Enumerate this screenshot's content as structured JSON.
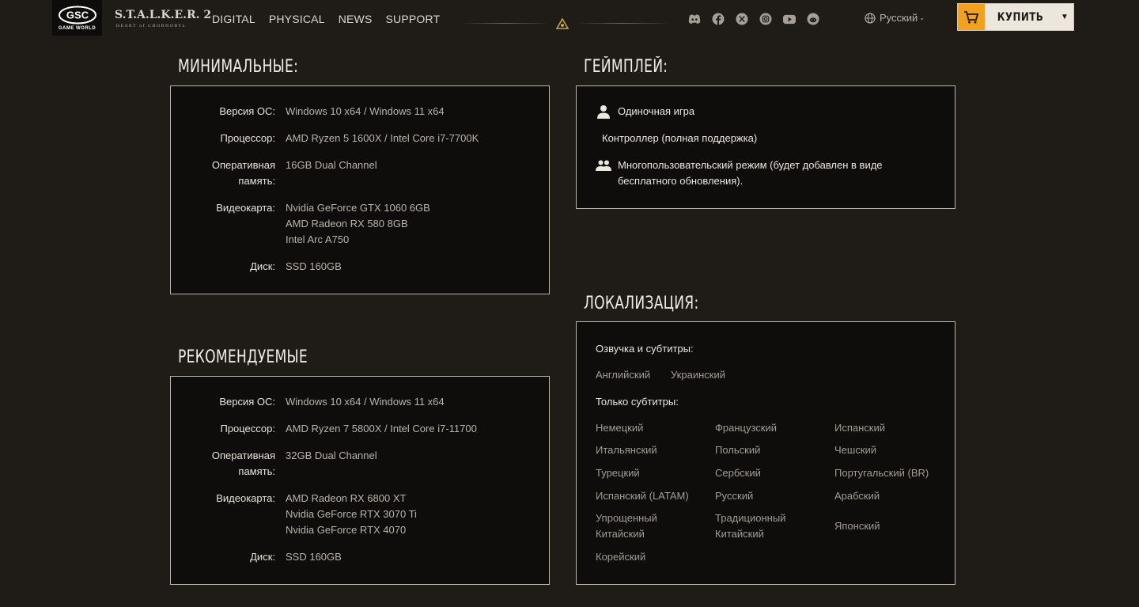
{
  "header": {
    "gsc_logo_text": "GAME WORLD",
    "stalker_title": "S.T.A.L.K.E.R. 2",
    "stalker_tagline": "HEART of CHORNOBYL",
    "nav": [
      "DIGITAL",
      "PHYSICAL",
      "NEWS",
      "SUPPORT"
    ],
    "socials": [
      "discord-icon",
      "facebook-icon",
      "x-icon",
      "instagram-icon",
      "youtube-icon",
      "reddit-icon"
    ],
    "language": "Русский",
    "buy_label": "КУПИТЬ",
    "accent_color": "#f2a01d"
  },
  "minimum": {
    "title": "МИНИМАЛЬНЫЕ:",
    "rows": [
      {
        "label": "Версия ОС:",
        "value": "Windows 10 x64 / Windows 11 x64"
      },
      {
        "label": "Процессор:",
        "value": "AMD Ryzen 5 1600X / Intel Core i7-7700K"
      },
      {
        "label": "Оперативная\nпамять:",
        "value": "16GB Dual Channel"
      },
      {
        "label": "Видеокарта:",
        "value": "Nvidia GeForce GTX 1060 6GB\nAMD Radeon RX 580 8GB\nIntel Arc A750"
      },
      {
        "label": "Диск:",
        "value": "SSD 160GB"
      }
    ]
  },
  "recommended": {
    "title": "РЕКОМЕНДУЕМЫЕ",
    "rows": [
      {
        "label": "Версия ОС:",
        "value": "Windows 10 x64 / Windows 11 x64"
      },
      {
        "label": "Процессор:",
        "value": "AMD Ryzen 7 5800X / Intel Core i7-11700"
      },
      {
        "label": "Оперативная\nпамять:",
        "value": "32GB Dual Channel"
      },
      {
        "label": "Видеокарта:",
        "value": "AMD Radeon RX 6800 XT\nNvidia GeForce RTX 3070 Ti\nNvidia GeForce RTX 4070"
      },
      {
        "label": "Диск:",
        "value": "SSD 160GB"
      }
    ]
  },
  "gameplay": {
    "title": "ГЕЙМПЛЕЙ:",
    "items": [
      {
        "icon": "single-player-icon",
        "text": "Одиночная игра"
      },
      {
        "icon": "",
        "text": "Контроллер (полная поддержка)"
      },
      {
        "icon": "multiplayer-icon",
        "text": "Многопользовательский режим (будет добавлен в виде\nбесплатного обновления)."
      }
    ]
  },
  "localization": {
    "title": "ЛОКАЛИЗАЦИЯ:",
    "voice_subs_label": "Озвучка и субтитры:",
    "voice_subs": [
      "Английский",
      "Украинский"
    ],
    "subs_only_label": "Только субтитры:",
    "subs_only": [
      "Немецкий",
      "Французский",
      "Испанский",
      "Итальянский",
      "Польский",
      "Чешский",
      "Турецкий",
      "Сербский",
      "Португальский (BR)",
      "Испанский (LATAM)",
      "Русский",
      "Арабский",
      "Упрощенный\nКитайский",
      "Традиционный\nКитайский",
      "Японский",
      "Корейский"
    ]
  }
}
